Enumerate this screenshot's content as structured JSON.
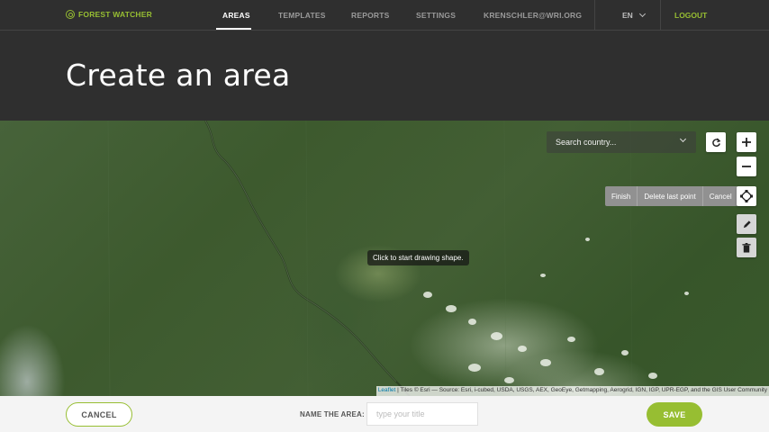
{
  "nav": {
    "brand": "FOREST WATCHER",
    "items": [
      {
        "label": "AREAS",
        "active": true
      },
      {
        "label": "TEMPLATES",
        "active": false
      },
      {
        "label": "REPORTS",
        "active": false
      },
      {
        "label": "SETTINGS",
        "active": false
      },
      {
        "label": "KRENSCHLER@WRI.ORG",
        "active": false
      }
    ],
    "language": "EN",
    "logout": "LOGOUT"
  },
  "header": {
    "title": "Create an area"
  },
  "map": {
    "search_placeholder": "Search country...",
    "draw_actions": {
      "finish": "Finish",
      "delete_last": "Delete last point",
      "cancel": "Cancel"
    },
    "tooltip": "Click to start drawing shape.",
    "attribution_link": "Leaflet",
    "attribution_text": " | Tiles © Esri — Source: Esri, i-cubed, USDA, USGS, AEX, GeoEye, Getmapping, Aerogrid, IGN, IGP, UPR-EGP, and the GIS User Community",
    "icons": [
      "refresh-icon",
      "zoom-in-icon",
      "zoom-out-icon",
      "polygon-draw-icon",
      "pencil-icon",
      "trash-icon"
    ]
  },
  "footer": {
    "cancel": "CANCEL",
    "name_label": "NAME THE AREA:",
    "name_placeholder": "type your title",
    "name_value": "",
    "save": "SAVE"
  },
  "colors": {
    "accent": "#97be32",
    "nav_bg": "#2f2f2f",
    "footer_bg": "#f4f4f4"
  }
}
